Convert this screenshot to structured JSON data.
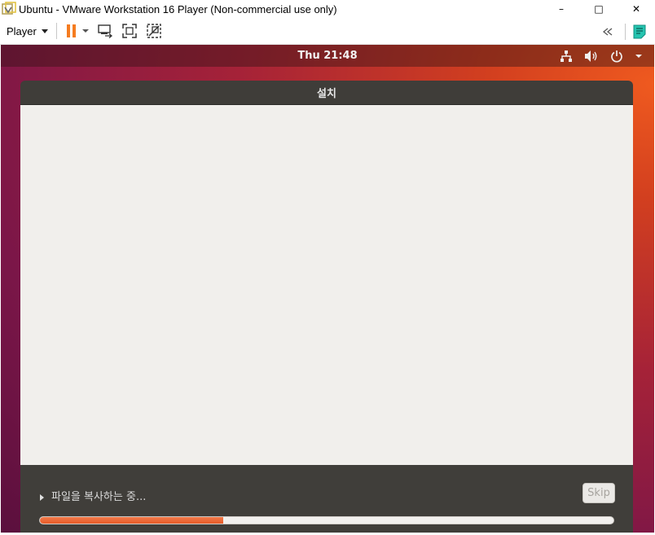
{
  "host_window": {
    "title": "Ubuntu - VMware Workstation 16 Player (Non-commercial use only)",
    "controls": {
      "minimize": "–",
      "maximize": "□",
      "close": "✕"
    }
  },
  "toolbar": {
    "player_label": "Player",
    "icons": [
      "pause-icon",
      "send-ctrl-alt-del-icon",
      "full-screen-icon",
      "unity-icon",
      "collapse-toolbar-icon",
      "notes-icon"
    ],
    "accent_color": "#f57c20"
  },
  "guest": {
    "clock": "Thu 21:48",
    "tray_icons": [
      "network-icon",
      "volume-icon",
      "power-icon",
      "chevron-down-icon"
    ]
  },
  "installer": {
    "title": "설치",
    "status_text": "파일을 복사하는 중...",
    "skip_label": "Skip",
    "progress_fraction": 0.32,
    "progress_color": "#e95420"
  }
}
